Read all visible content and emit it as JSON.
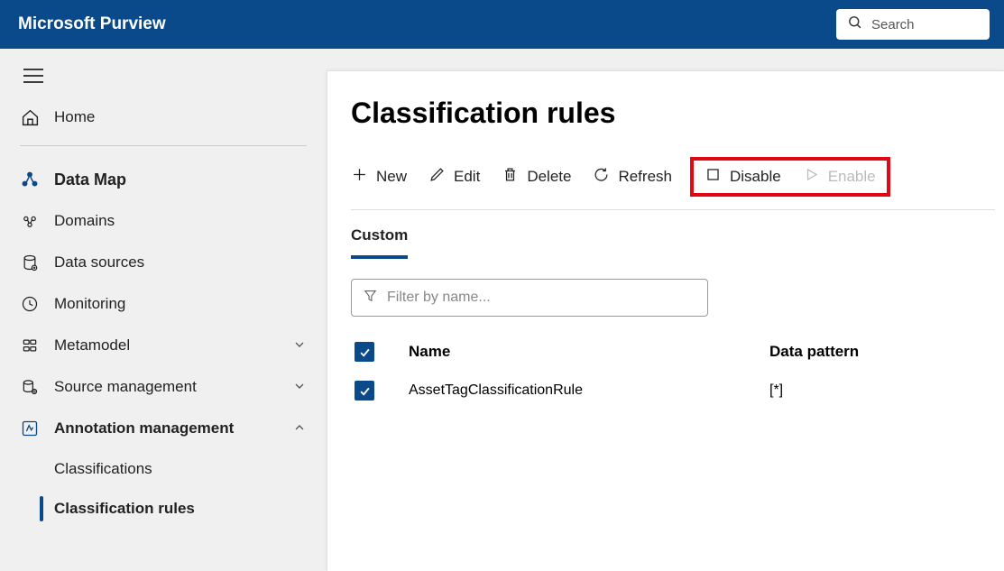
{
  "header": {
    "brand": "Microsoft Purview",
    "search_placeholder": "Search"
  },
  "sidebar": {
    "home": "Home",
    "section": "Data Map",
    "items": [
      {
        "icon": "domains",
        "label": "Domains"
      },
      {
        "icon": "datasources",
        "label": "Data sources"
      },
      {
        "icon": "monitoring",
        "label": "Monitoring"
      },
      {
        "icon": "metamodel",
        "label": "Metamodel",
        "chevron": "down"
      },
      {
        "icon": "sourcemgmt",
        "label": "Source management",
        "chevron": "down"
      },
      {
        "icon": "annotation",
        "label": "Annotation management",
        "chevron": "up",
        "bold": true
      }
    ],
    "subitems": [
      {
        "label": "Classifications",
        "active": false
      },
      {
        "label": "Classification rules",
        "active": true
      }
    ]
  },
  "main": {
    "title": "Classification rules",
    "toolbar": {
      "new": "New",
      "edit": "Edit",
      "delete": "Delete",
      "refresh": "Refresh",
      "disable": "Disable",
      "enable": "Enable"
    },
    "tabs": [
      {
        "label": "Custom",
        "active": true
      }
    ],
    "filter_placeholder": "Filter by name...",
    "table": {
      "columns": {
        "name": "Name",
        "data_pattern": "Data pattern"
      },
      "rows": [
        {
          "name": "AssetTagClassificationRule",
          "data_pattern": "[*]"
        }
      ]
    }
  }
}
